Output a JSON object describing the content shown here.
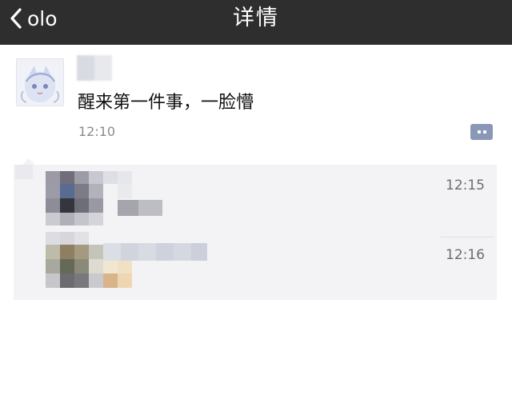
{
  "nav": {
    "back_label": "olo",
    "title": "详情"
  },
  "post": {
    "text": "醒来第一件事，一脸懵",
    "time": "12:10"
  },
  "comments": [
    {
      "time": "12:15"
    },
    {
      "time": "12:16"
    }
  ],
  "icons": {
    "back": "chevron-left-icon",
    "comment": "comment-icon"
  },
  "colors": {
    "nav_bg": "#2e2e2f",
    "comment_bg": "#f3f3f5",
    "comment_icon": "#8a97b6"
  }
}
